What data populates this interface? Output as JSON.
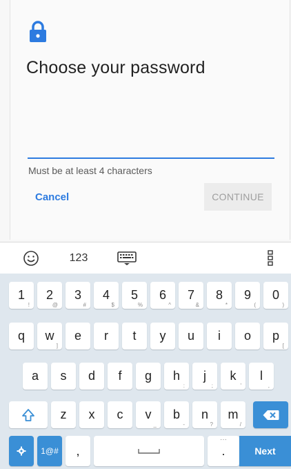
{
  "dialog": {
    "title": "Choose your password",
    "hint": "Must be at least 4 characters",
    "cancel_label": "Cancel",
    "continue_label": "CONTINUE",
    "password_value": ""
  },
  "toolbar": {
    "numbers_label": "123"
  },
  "keyboard": {
    "row1": [
      {
        "k": "1",
        "h": "!"
      },
      {
        "k": "2",
        "h": "@"
      },
      {
        "k": "3",
        "h": "#"
      },
      {
        "k": "4",
        "h": "$"
      },
      {
        "k": "5",
        "h": "%"
      },
      {
        "k": "6",
        "h": "^"
      },
      {
        "k": "7",
        "h": "&"
      },
      {
        "k": "8",
        "h": "*"
      },
      {
        "k": "9",
        "h": "("
      },
      {
        "k": "0",
        "h": ")"
      }
    ],
    "row2": [
      {
        "k": "q",
        "h": ""
      },
      {
        "k": "w",
        "h": "]"
      },
      {
        "k": "e",
        "h": ""
      },
      {
        "k": "r",
        "h": ""
      },
      {
        "k": "t",
        "h": ""
      },
      {
        "k": "y",
        "h": ""
      },
      {
        "k": "u",
        "h": ""
      },
      {
        "k": "i",
        "h": ""
      },
      {
        "k": "o",
        "h": ""
      },
      {
        "k": "p",
        "h": "["
      }
    ],
    "row3": [
      {
        "k": "a",
        "h": ""
      },
      {
        "k": "s",
        "h": ""
      },
      {
        "k": "d",
        "h": ""
      },
      {
        "k": "f",
        "h": ""
      },
      {
        "k": "g",
        "h": ""
      },
      {
        "k": "h",
        "h": ":"
      },
      {
        "k": "j",
        "h": ";"
      },
      {
        "k": "k",
        "h": "'"
      },
      {
        "k": "l",
        "h": ","
      }
    ],
    "row4": [
      {
        "k": "z",
        "h": ""
      },
      {
        "k": "x",
        "h": ""
      },
      {
        "k": "c",
        "h": ""
      },
      {
        "k": "v",
        "h": "_"
      },
      {
        "k": "b",
        "h": "-"
      },
      {
        "k": "n",
        "h": "?"
      },
      {
        "k": "m",
        "h": "/"
      }
    ],
    "sym_label": "1@#",
    "comma_label": ",",
    "period_label": ".",
    "next_label": "Next",
    "accent_color": "#3a8fd6"
  }
}
